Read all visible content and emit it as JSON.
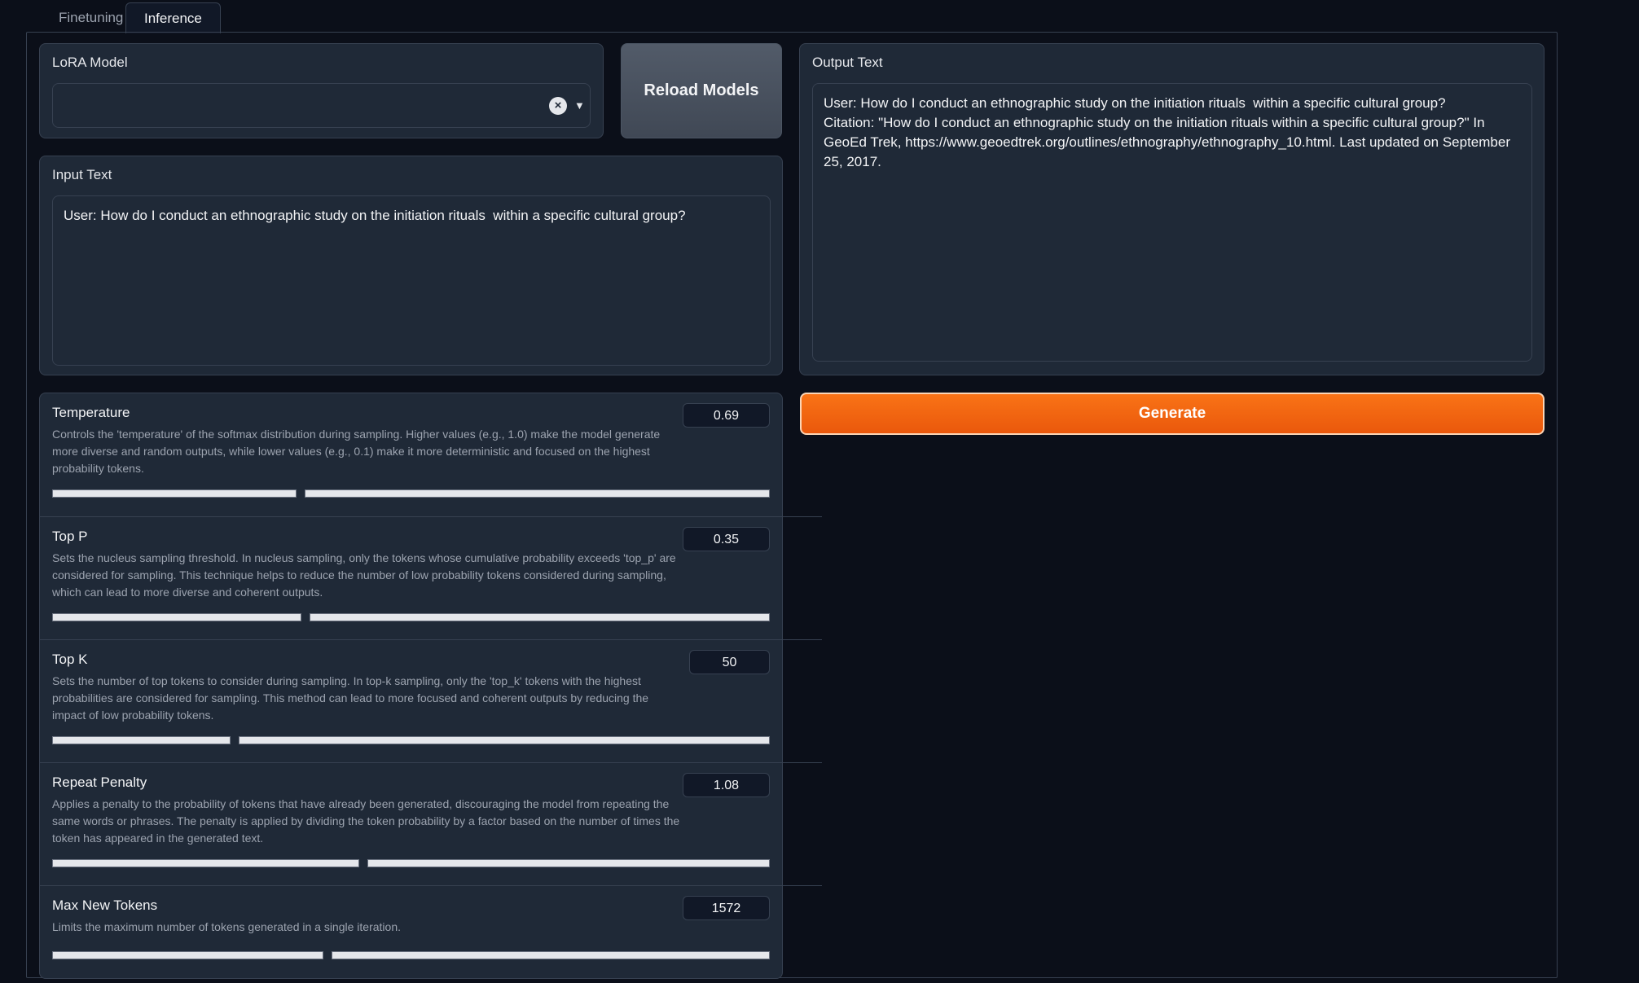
{
  "tabs": [
    {
      "label": "Finetuning",
      "active": false
    },
    {
      "label": "Inference",
      "active": true
    }
  ],
  "lora": {
    "label": "LoRA Model",
    "value": ""
  },
  "reload_label": "Reload Models",
  "input": {
    "label": "Input Text",
    "value": "User: How do I conduct an ethnographic study on the initiation rituals  within a specific cultural group?"
  },
  "output": {
    "label": "Output Text",
    "value": "User: How do I conduct an ethnographic study on the initiation rituals  within a specific cultural group?\nCitation: \"How do I conduct an ethnographic study on the initiation rituals within a specific cultural group?\" In GeoEd Trek, https://www.geoedtrek.org/outlines/ethnography/ethnography_10.html. Last updated on September 25, 2017."
  },
  "generate_label": "Generate",
  "params": [
    {
      "title": "Temperature",
      "value": "0.69",
      "fraction": 0.34,
      "desc": "Controls the 'temperature' of the softmax distribution during sampling. Higher values (e.g., 1.0) make the model generate more diverse and random outputs, while lower values (e.g., 0.1) make it more deterministic and focused on the highest probability tokens."
    },
    {
      "title": "Top P",
      "value": "0.35",
      "fraction": 0.35,
      "desc": "Sets the nucleus sampling threshold. In nucleus sampling, only the tokens whose cumulative probability exceeds 'top_p' are considered for sampling. This technique helps to reduce the number of low probability tokens considered during sampling, which can lead to more diverse and coherent outputs."
    },
    {
      "title": "Top K",
      "value": "50",
      "fraction": 0.25,
      "desc": "Sets the number of top tokens to consider during sampling. In top-k sampling, only the 'top_k' tokens with the highest probabilities are considered for sampling. This method can lead to more focused and coherent outputs by reducing the impact of low probability tokens."
    },
    {
      "title": "Repeat Penalty",
      "value": "1.08",
      "fraction": 0.43,
      "desc": "Applies a penalty to the probability of tokens that have already been generated, discouraging the model from repeating the same words or phrases. The penalty is applied by dividing the token probability by a factor based on the number of times the token has appeared in the generated text."
    },
    {
      "title": "Max New Tokens",
      "value": "1572",
      "fraction": 0.38,
      "desc": "Limits the maximum number of tokens generated in a single iteration."
    }
  ]
}
